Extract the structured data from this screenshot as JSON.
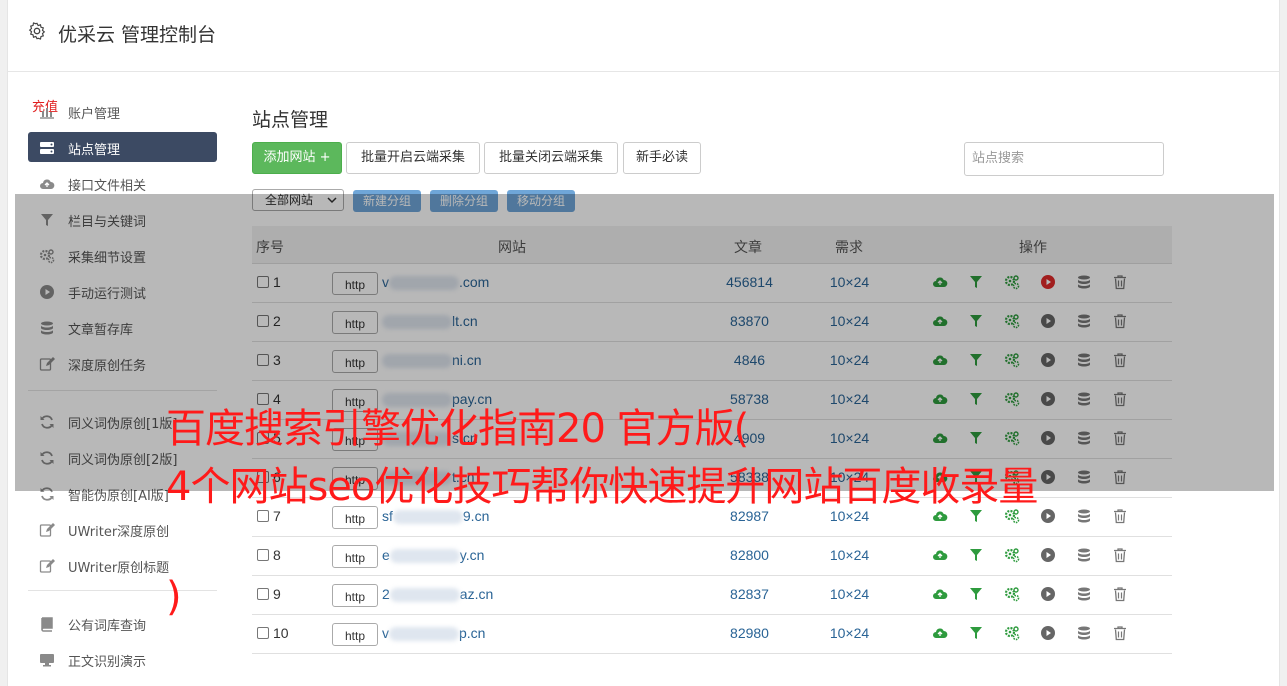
{
  "app": {
    "title": "优采云 管理控制台"
  },
  "sidebar": {
    "items": [
      {
        "label": "账户管理",
        "extra": "充值",
        "icon": "bar-chart-icon"
      },
      {
        "label": "站点管理",
        "icon": "server-icon",
        "active": true
      },
      {
        "label": "接口文件相关",
        "icon": "cloud-upload-icon"
      },
      {
        "label": "栏目与关键词",
        "icon": "filter-icon"
      },
      {
        "label": "采集细节设置",
        "icon": "gears-icon"
      },
      {
        "label": "手动运行测试",
        "icon": "play-circle-icon"
      },
      {
        "label": "文章暂存库",
        "icon": "database-icon"
      },
      {
        "label": "深度原创任务",
        "icon": "edit-icon"
      },
      {
        "label": "同义词伪原创[1版]",
        "icon": "refresh-icon"
      },
      {
        "label": "同义词伪原创[2版]",
        "icon": "refresh-icon"
      },
      {
        "label": "智能伪原创[AI版]",
        "icon": "refresh-icon"
      },
      {
        "label": "UWriter深度原创",
        "icon": "edit-icon"
      },
      {
        "label": "UWriter原创标题",
        "icon": "edit-icon"
      },
      {
        "label": "公有词库查询",
        "icon": "book-icon"
      },
      {
        "label": "正文识别演示",
        "icon": "monitor-icon"
      }
    ]
  },
  "main": {
    "title": "站点管理",
    "buttons": {
      "add_site": "添加网站 +",
      "batch_open": "批量开启云端采集",
      "batch_close": "批量关闭云端采集",
      "beginner": "新手必读"
    },
    "search_placeholder": "站点搜索",
    "group_select": "全部网站",
    "group_buttons": {
      "new": "新建分组",
      "delete": "删除分组",
      "move": "移动分组"
    },
    "table": {
      "headers": {
        "index": "序号",
        "site": "网站",
        "articles": "文章",
        "demand": "需求",
        "ops": "操作"
      },
      "rows": [
        {
          "index": "1",
          "proto": "http",
          "site_prefix": "v",
          "site_suffix": ".com",
          "articles": "456814",
          "demand": "10×24",
          "running": true
        },
        {
          "index": "2",
          "proto": "http",
          "site_prefix": "",
          "site_suffix": "lt.cn",
          "articles": "83870",
          "demand": "10×24",
          "running": false
        },
        {
          "index": "3",
          "proto": "http",
          "site_prefix": "",
          "site_suffix": "ni.cn",
          "articles": "4846",
          "demand": "10×24",
          "running": false
        },
        {
          "index": "4",
          "proto": "http",
          "site_prefix": "",
          "site_suffix": "pay.cn",
          "articles": "58738",
          "demand": "10×24",
          "running": false
        },
        {
          "index": "5",
          "proto": "http",
          "site_prefix": "",
          "site_suffix": "s.cn",
          "articles": "4909",
          "demand": "10×24",
          "running": false
        },
        {
          "index": "6",
          "proto": "http",
          "site_prefix": "",
          "site_suffix": "t.cn",
          "articles": "58338",
          "demand": "10×24",
          "running": false
        },
        {
          "index": "7",
          "proto": "http",
          "site_prefix": "sf",
          "site_suffix": "9.cn",
          "articles": "82987",
          "demand": "10×24",
          "running": false
        },
        {
          "index": "8",
          "proto": "http",
          "site_prefix": "e",
          "site_suffix": "y.cn",
          "articles": "82800",
          "demand": "10×24",
          "running": false
        },
        {
          "index": "9",
          "proto": "http",
          "site_prefix": "2",
          "site_suffix": "az.cn",
          "articles": "82837",
          "demand": "10×24",
          "running": false
        },
        {
          "index": "10",
          "proto": "http",
          "site_prefix": "v",
          "site_suffix": "p.cn",
          "articles": "82980",
          "demand": "10×24",
          "running": false
        }
      ]
    }
  },
  "headline": {
    "line1": "百度搜索引擎优化指南20 官方版(",
    "line2": "4个网站seo优化技巧帮你快速提升网站百度收录量",
    "line3": ")"
  },
  "colors": {
    "active_nav": "#3c4a63",
    "green": "#5cb85c",
    "link": "#2a6496",
    "headline": "#ff1a1a",
    "group_btn": "#6fa6d8"
  }
}
